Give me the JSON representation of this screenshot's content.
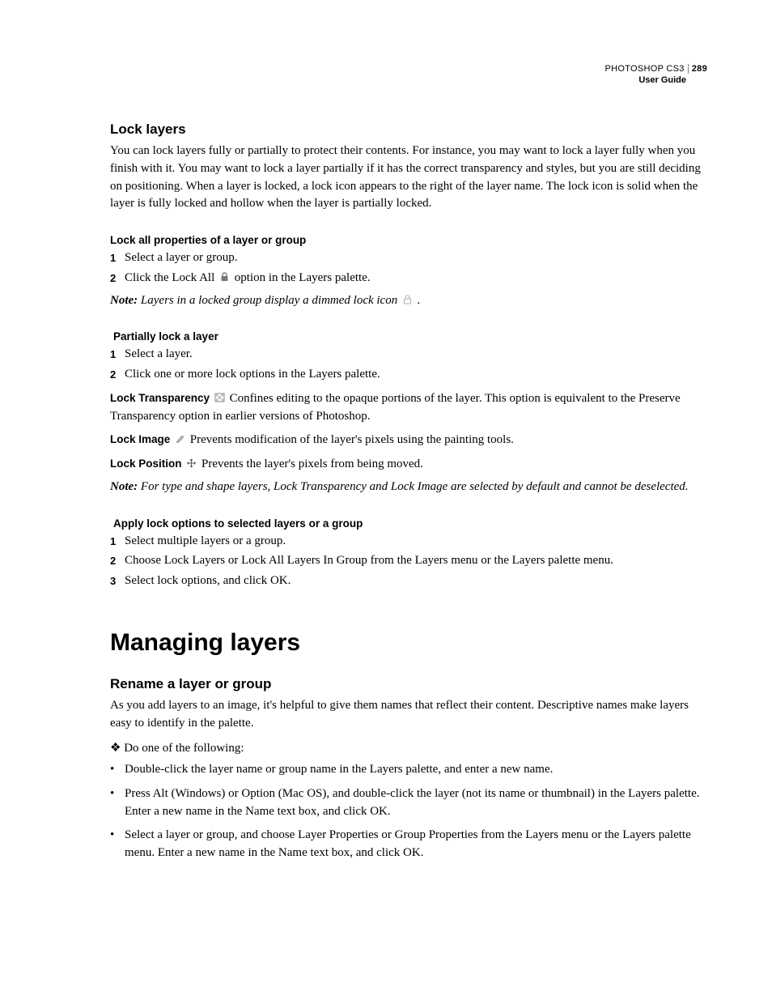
{
  "header": {
    "product": "PHOTOSHOP CS3",
    "page": "289",
    "guide": "User Guide"
  },
  "s1": {
    "title": "Lock layers",
    "intro": "You can lock layers fully or partially to protect their contents. For instance, you may want to lock a layer fully when you finish with it. You may want to lock a layer partially if it has the correct transparency and styles, but you are still deciding on positioning. When a layer is locked, a lock icon appears to the right of the layer name. The lock icon is solid when the layer is fully locked and hollow when the layer is partially locked.",
    "sub1": {
      "title": "Lock all properties of a layer or group",
      "step1": "Select a layer or group.",
      "step2a": "Click the Lock All ",
      "step2b": " option in the Layers palette.",
      "note_label": "Note:",
      "note_text_a": " Layers in a locked group display a dimmed lock icon ",
      "note_text_b": " ."
    },
    "sub2": {
      "title": "Partially lock a layer",
      "step1": "Select a layer.",
      "step2": "Click one or more lock options in the Layers palette.",
      "lt_label": "Lock Transparency",
      "lt_text": "  Confines editing to the opaque portions of the layer. This option is equivalent to the Preserve Transparency option in earlier versions of Photoshop.",
      "li_label": "Lock Image",
      "li_text": "  Prevents modification of the layer's pixels using the painting tools.",
      "lp_label": "Lock Position",
      "lp_text": "  Prevents the layer's pixels from being moved.",
      "note_label": "Note:",
      "note_text": " For type and shape layers, Lock Transparency and Lock Image are selected by default and cannot be deselected."
    },
    "sub3": {
      "title": "Apply lock options to selected layers or a group",
      "step1": "Select multiple layers or a group.",
      "step2": "Choose Lock Layers or Lock All Layers In Group from the Layers menu or the Layers palette menu.",
      "step3": "Select lock options, and click OK."
    }
  },
  "s2": {
    "chapter": "Managing layers",
    "title": "Rename a layer or group",
    "intro": "As you add layers to an image, it's helpful to give them names that reflect their content. Descriptive names make layers easy to identify in the palette.",
    "diamond": "❖ Do one of the following:",
    "b1": "Double-click the layer name or group name in the Layers palette, and enter a new name.",
    "b2": "Press Alt (Windows) or Option (Mac OS), and double-click the layer (not its name or thumbnail) in the Layers palette. Enter a new name in the Name text box, and click OK.",
    "b3": "Select a layer or group, and choose Layer Properties or Group Properties from the Layers menu or the Layers palette menu. Enter a new name in the Name text box, and click OK."
  },
  "nums": {
    "1": "1",
    "2": "2",
    "3": "3"
  },
  "bullet": "•"
}
